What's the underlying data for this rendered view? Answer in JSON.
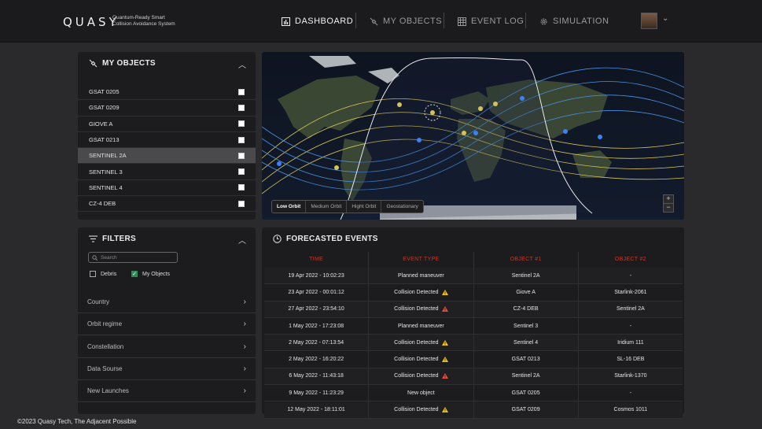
{
  "brand": {
    "name": "QUASY",
    "tagline": "Quantum-Ready Smart Collision Avoidance System"
  },
  "nav": [
    {
      "label": "DASHBOARD",
      "icon": "bar-chart-icon",
      "active": true
    },
    {
      "label": "MY OBJECTS",
      "icon": "satellite-icon",
      "active": false
    },
    {
      "label": "EVENT LOG",
      "icon": "calendar-grid-icon",
      "active": false
    },
    {
      "label": "SIMULATION",
      "icon": "gear-icon",
      "active": false
    }
  ],
  "my_objects": {
    "title": "MY OBJECTS",
    "items": [
      {
        "label": "GSAT 0205",
        "selected": false
      },
      {
        "label": "GSAT 0209",
        "selected": false
      },
      {
        "label": "GIOVE A",
        "selected": false
      },
      {
        "label": "GSAT 0213",
        "selected": false
      },
      {
        "label": "SENTINEL 2A",
        "selected": true
      },
      {
        "label": "SENTINEL 3",
        "selected": false
      },
      {
        "label": "SENTINEL 4",
        "selected": false
      },
      {
        "label": "CZ-4 DEB",
        "selected": false
      }
    ]
  },
  "filters": {
    "title": "FILTERS",
    "search_placeholder": "Search",
    "options": [
      {
        "label": "Debris",
        "checked": false
      },
      {
        "label": "My Objects",
        "checked": true
      }
    ],
    "rows": [
      "Country",
      "Orbit regime",
      "Constellation",
      "Data Sourse",
      "New Launches"
    ]
  },
  "map": {
    "orbit_tabs": [
      "Low Orbit",
      "Medium Orbit",
      "Hight Orbit",
      "Geostationary"
    ],
    "active_tab": "Low Orbit",
    "zoom_in": "+",
    "zoom_out": "−"
  },
  "events": {
    "title": "FORECASTED EVENTS",
    "columns": [
      "TIME",
      "EVENT TYPE",
      "OBJECT #1",
      "OBJECT #2"
    ],
    "rows": [
      {
        "time": "19 Apr 2022 - 10:02:23",
        "type": "Planned maneuver",
        "warn": "",
        "obj1": "Sentinel 2A",
        "obj2": "-"
      },
      {
        "time": "23 Apr 2022 - 00:01:12",
        "type": "Collision Detected",
        "warn": "yellow",
        "obj1": "Giove A",
        "obj2": "Starlink-2061"
      },
      {
        "time": "27 Apr 2022 - 23:54:10",
        "type": "Collision Detected",
        "warn": "red",
        "obj1": "CZ-4 DEB",
        "obj2": "Sentinel 2A"
      },
      {
        "time": "1 May 2022 - 17:23:08",
        "type": "Planned maneuver",
        "warn": "",
        "obj1": "Sentinel 3",
        "obj2": "-"
      },
      {
        "time": "2 May 2022 - 07:13:54",
        "type": "Collision Detected",
        "warn": "yellow",
        "obj1": "Sentinel 4",
        "obj2": "Iridium 111"
      },
      {
        "time": "2 May 2022 - 16:20:22",
        "type": "Collision Detected",
        "warn": "yellow",
        "obj1": "GSAT 0213",
        "obj2": "SL-16 DEB"
      },
      {
        "time": "6 May 2022 - 11:43:18",
        "type": "Collision Detected",
        "warn": "red",
        "obj1": "Sentinel 2A",
        "obj2": "Starlink-1370"
      },
      {
        "time": "9 May 2022 - 11:23:29",
        "type": "New object",
        "warn": "",
        "obj1": "GSAT 0205",
        "obj2": "-"
      },
      {
        "time": "12 May 2022 - 18:11:01",
        "type": "Collision Detected",
        "warn": "yellow",
        "obj1": "GSAT 0209",
        "obj2": "Cosmos 1011"
      }
    ]
  },
  "colors": {
    "warn_yellow": "#f1c40f",
    "warn_red": "#e74c3c",
    "header_red": "#c0392b",
    "check_green": "#2e8b57"
  },
  "footer": "©2023 Quasy Tech, The Adjacent Possible"
}
